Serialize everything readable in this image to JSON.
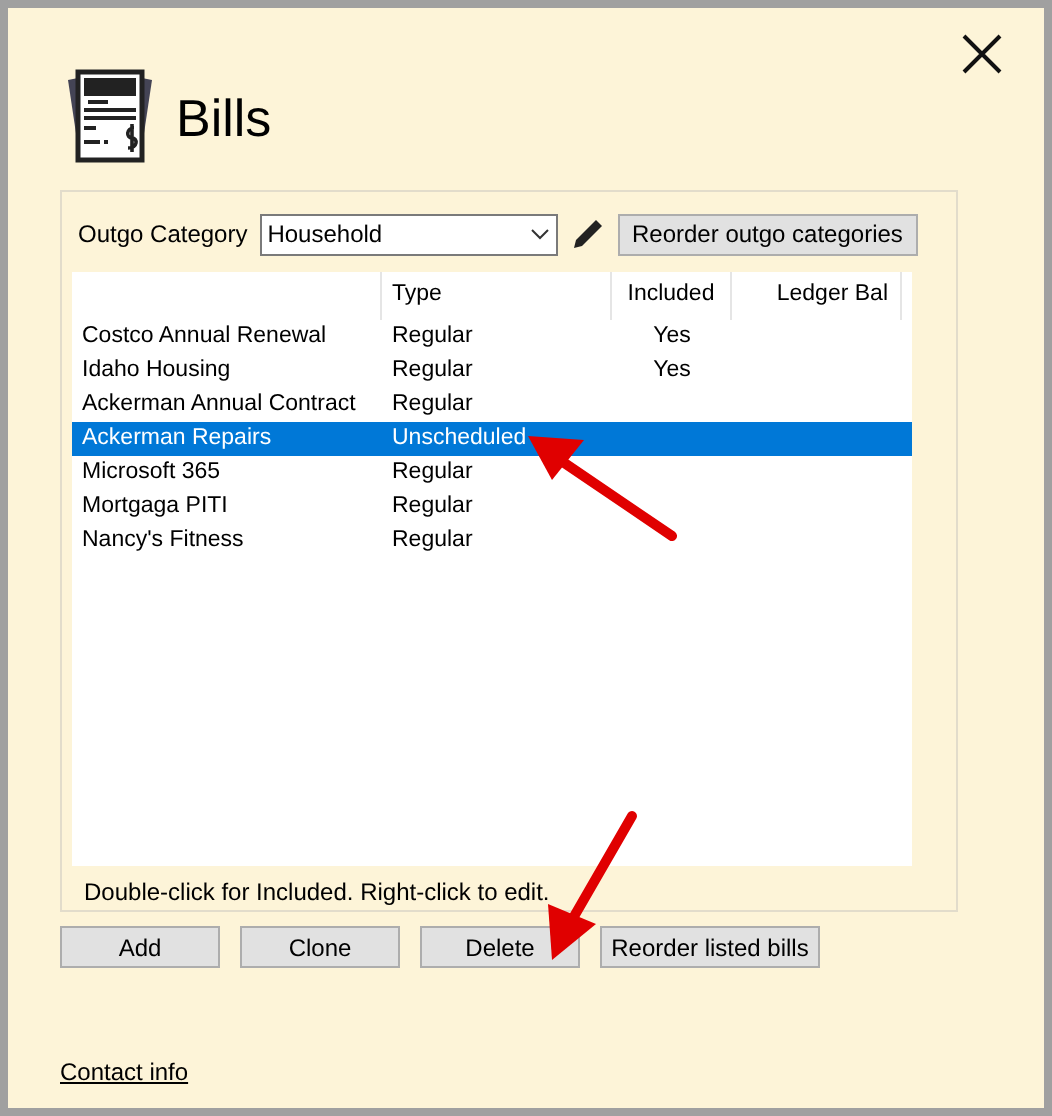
{
  "window": {
    "title": "Bills"
  },
  "category": {
    "label": "Outgo Category",
    "value": "Household",
    "reorder_button": "Reorder outgo categories"
  },
  "table": {
    "columns": [
      "Type",
      "Included",
      "Ledger Bal"
    ],
    "rows": [
      {
        "name": "Costco Annual Renewal",
        "type": "Regular",
        "included": "Yes",
        "selected": false
      },
      {
        "name": "Idaho Housing",
        "type": "Regular",
        "included": "Yes",
        "selected": false
      },
      {
        "name": "Ackerman Annual Contract",
        "type": "Regular",
        "selected": false
      },
      {
        "name": "Ackerman Repairs",
        "type": "Unscheduled",
        "selected": true
      },
      {
        "name": "Microsoft 365",
        "type": "Regular",
        "selected": false
      },
      {
        "name": "Mortgaga PITI",
        "type": "Regular",
        "selected": false
      },
      {
        "name": "Nancy's Fitness",
        "type": "Regular",
        "selected": false
      }
    ]
  },
  "hint": "Double-click for Included. Right-click to edit.",
  "buttons": [
    "Add",
    "Clone",
    "Delete",
    "Reorder listed bills"
  ],
  "link": "Contact info"
}
